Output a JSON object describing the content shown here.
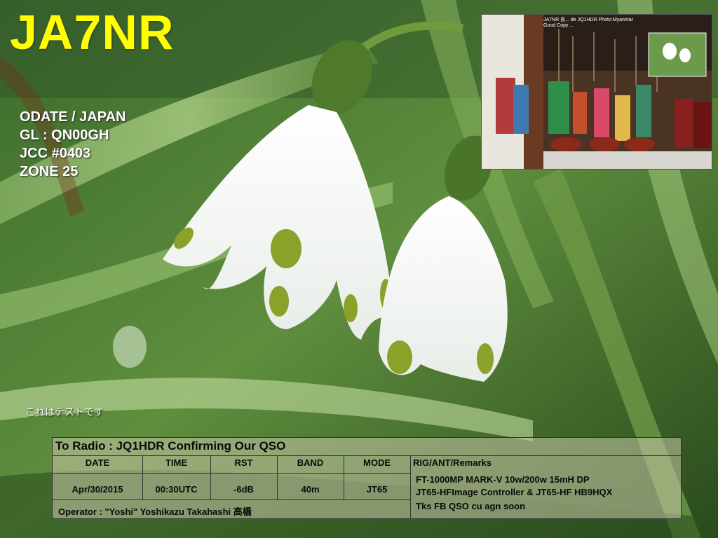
{
  "callsign": "JA7NR",
  "station": {
    "location": "ODATE / JAPAN",
    "grid": "GL : QN00GH",
    "jcc": "JCC #0403",
    "zone": "ZONE 25"
  },
  "inset": {
    "caption_line1": "JA7NR 長...   de JQ1HDR   Photo:Myanmar",
    "caption_line2": "Good Copy ..."
  },
  "test_note": "これはテストです",
  "card": {
    "title": "To Radio : JQ1HDR   Confirming Our QSO",
    "headers": {
      "date": "DATE",
      "time": "TIME",
      "rst": "RST",
      "band": "BAND",
      "mode": "MODE",
      "remarks": "RIG/ANT/Remarks"
    },
    "values": {
      "date": "Apr/30/2015",
      "time": "00:30UTC",
      "rst": "-6dB",
      "band": "40m",
      "mode": "JT65"
    },
    "remarks": [
      "FT-1000MP MARK-V  10w/200w     15mH DP",
      "JT65-HFImage Controller & JT65-HF HB9HQX",
      "Tks FB QSO cu agn soon"
    ],
    "operator": "Operator : \"Yoshi\"  Yoshikazu  Takahashi   高橋"
  }
}
